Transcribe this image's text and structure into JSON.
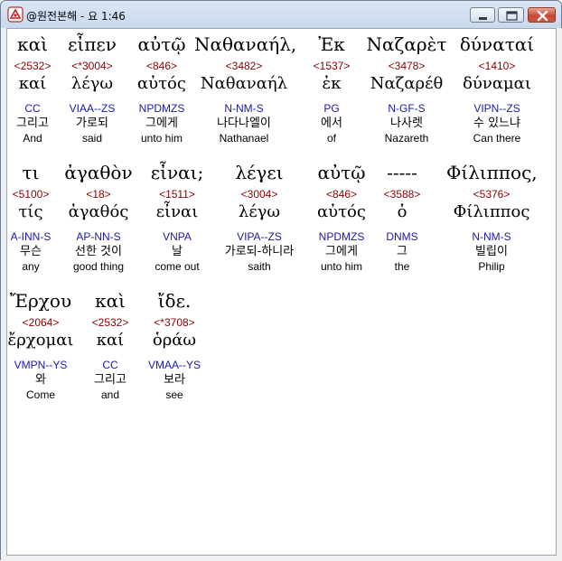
{
  "window": {
    "title": "@원전본해 - 요 1:46",
    "minimize_icon": "minimize-icon",
    "maximize_icon": "maximize-icon",
    "close_icon": "close-icon"
  },
  "rows": [
    {
      "words": [
        {
          "greek": "καὶ",
          "strong": "<2532>",
          "lemma": "καί",
          "parse": "CC",
          "korean": "그리고",
          "english": "And"
        },
        {
          "greek": "εἶπεν",
          "strong": "<*3004>",
          "lemma": "λέγω",
          "parse": "VIAA--ZS",
          "korean": "가로되",
          "english": "said"
        },
        {
          "greek": "αὐτῷ",
          "strong": "<846>",
          "lemma": "αὐτός",
          "parse": "NPDMZS",
          "korean": "그에게",
          "english": "unto him"
        },
        {
          "greek": "Ναθαναήλ,",
          "strong": "<3482>",
          "lemma": "Ναθαναήλ",
          "parse": "N-NM-S",
          "korean": "나다나엘이",
          "english": "Nathanael"
        },
        {
          "greek": "Ἐκ",
          "strong": "<1537>",
          "lemma": "ἐκ",
          "parse": "PG",
          "korean": "에서",
          "english": "of"
        },
        {
          "greek": "Ναζαρὲτ",
          "strong": "<3478>",
          "lemma": "Ναζαρέθ",
          "parse": "N-GF-S",
          "korean": "나사렛",
          "english": "Nazareth"
        },
        {
          "greek": "δύναταί",
          "strong": "<1410>",
          "lemma": "δύναμαι",
          "parse": "VIPN--ZS",
          "korean": "수 있느냐",
          "english": "Can there"
        }
      ]
    },
    {
      "words": [
        {
          "greek": "τι",
          "strong": "<5100>",
          "lemma": "τίς",
          "parse": "A-INN-S",
          "korean": "무슨",
          "english": "any"
        },
        {
          "greek": "ἀγαθὸν",
          "strong": "<18>",
          "lemma": "ἀγαθός",
          "parse": "AP-NN-S",
          "korean": "선한 것이",
          "english": "good thing"
        },
        {
          "greek": "εἶναι;",
          "strong": "<1511>",
          "lemma": "εἶναι",
          "parse": "VNPA",
          "korean": "날",
          "english": "come out"
        },
        {
          "greek": "λέγει",
          "strong": "<3004>",
          "lemma": "λέγω",
          "parse": "VIPA--ZS",
          "korean": "가로되-하니라",
          "english": "saith"
        },
        {
          "greek": "αὐτῷ",
          "strong": "<846>",
          "lemma": "αὐτός",
          "parse": "NPDMZS",
          "korean": "그에게",
          "english": "unto him"
        },
        {
          "greek": "-----",
          "strong": "<3588>",
          "lemma": "ὁ",
          "parse": "DNMS",
          "korean": "그",
          "english": "the"
        },
        {
          "greek": "Φίλιππος,",
          "strong": "<5376>",
          "lemma": "Φίλιππος",
          "parse": "N-NM-S",
          "korean": "빌립이",
          "english": "Philip"
        }
      ]
    },
    {
      "words": [
        {
          "greek": "Ἔρχου",
          "strong": "<2064>",
          "lemma": "ἔρχομαι",
          "parse": "VMPN--YS",
          "korean": "와",
          "english": "Come"
        },
        {
          "greek": "καὶ",
          "strong": "<2532>",
          "lemma": "καί",
          "parse": "CC",
          "korean": "그리고",
          "english": "and"
        },
        {
          "greek": "ἴδε.",
          "strong": "<*3708>",
          "lemma": "ὁράω",
          "parse": "VMAA--YS",
          "korean": "보라",
          "english": "see"
        }
      ]
    }
  ]
}
